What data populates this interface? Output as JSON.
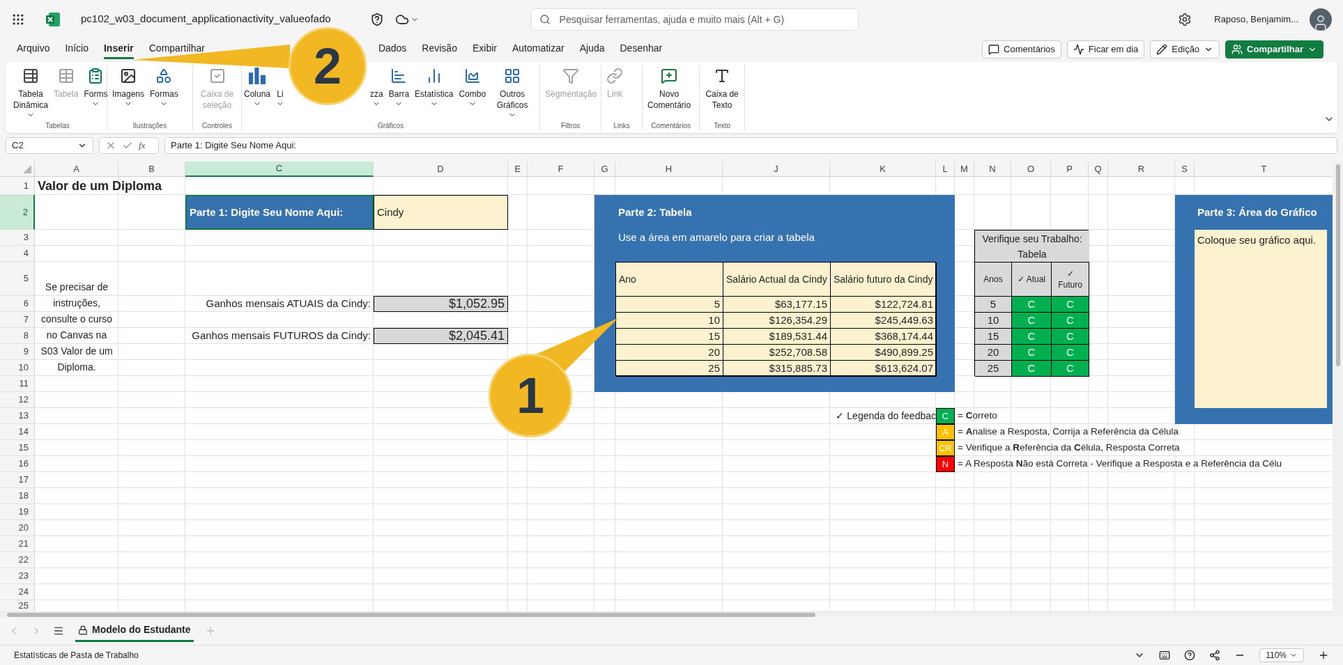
{
  "title_bar": {
    "document_title": "pc102_w03_document_applicationactivity_valueofado",
    "search": {
      "placeholder": "Pesquisar ferramentas, ajuda e muito mais (Alt + G)"
    },
    "user_name": "Raposo, Benjamim..."
  },
  "menu_tabs": [
    {
      "label": "Arquivo",
      "selected": false
    },
    {
      "label": "Início",
      "selected": false
    },
    {
      "label": "Inserir",
      "selected": true
    },
    {
      "label": "Compartilhar",
      "selected": false
    },
    {
      "label": "Dados",
      "selected": false
    },
    {
      "label": "Revisão",
      "selected": false
    },
    {
      "label": "Exibir",
      "selected": false
    },
    {
      "label": "Automatizar",
      "selected": false
    },
    {
      "label": "Ajuda",
      "selected": false
    },
    {
      "label": "Desenhar",
      "selected": false
    }
  ],
  "header_buttons": [
    {
      "label": "Comentários",
      "kind": "comments"
    },
    {
      "label": "Ficar em dia",
      "kind": "catchup"
    },
    {
      "label": "Edição",
      "kind": "editing"
    },
    {
      "label": "Compartilhar",
      "kind": "share"
    }
  ],
  "ribbon": [
    {
      "label": "Tabelas",
      "items": [
        {
          "label": "Tabela Dinâmica",
          "kind": "pivot",
          "disabled": false,
          "menu": true
        },
        {
          "label": "Tabela",
          "kind": "table",
          "disabled": true,
          "menu": false
        },
        {
          "label": "Forms",
          "kind": "forms",
          "disabled": false,
          "menu": true
        }
      ]
    },
    {
      "label": "Ilustrações",
      "items": [
        {
          "label": "Imagens",
          "kind": "image",
          "disabled": false,
          "menu": true
        },
        {
          "label": "Formas",
          "kind": "shapes",
          "disabled": false,
          "menu": true
        }
      ]
    },
    {
      "label": "Controles",
      "items": [
        {
          "label": "Caixa de seleção",
          "kind": "checkbox",
          "disabled": true,
          "menu": false
        }
      ]
    },
    {
      "label": "Gráficos",
      "items": [
        {
          "label": "Coluna",
          "kind": "column",
          "disabled": false,
          "menu": true
        },
        {
          "label": "Li",
          "kind": "partial",
          "disabled": false,
          "menu": true
        },
        {
          "label": "zza",
          "kind": "partial",
          "disabled": false,
          "menu": true
        },
        {
          "label": "Barra",
          "kind": "bar",
          "disabled": false,
          "menu": true
        },
        {
          "label": "Estatística",
          "kind": "stat",
          "disabled": false,
          "menu": true
        },
        {
          "label": "Combo",
          "kind": "combo",
          "disabled": false,
          "menu": true
        },
        {
          "label": "Outros Gráficos",
          "kind": "other",
          "disabled": false,
          "menu": true
        }
      ]
    },
    {
      "label": "Filtros",
      "items": [
        {
          "label": "Segmentação",
          "kind": "slicer",
          "disabled": true,
          "menu": false
        }
      ]
    },
    {
      "label": "Links",
      "items": [
        {
          "label": "Link",
          "kind": "link",
          "disabled": true,
          "menu": false
        }
      ]
    },
    {
      "label": "Comentários",
      "items": [
        {
          "label": "Novo Comentário",
          "kind": "comment",
          "disabled": false,
          "menu": false
        }
      ]
    },
    {
      "label": "Texto",
      "items": [
        {
          "label": "Caixa de Texto",
          "kind": "textbox",
          "disabled": false,
          "menu": false
        }
      ]
    }
  ],
  "formula_bar": {
    "name_box": "C2",
    "function_label": "fx",
    "formula": "Parte 1: Digite Seu Nome Aqui:"
  },
  "column_headers": [
    {
      "label": "A",
      "selected": false
    },
    {
      "label": "B",
      "selected": false
    },
    {
      "label": "C",
      "selected": true
    },
    {
      "label": "D",
      "selected": false
    },
    {
      "label": "E",
      "selected": false
    },
    {
      "label": "F",
      "selected": false
    },
    {
      "label": "G",
      "selected": false
    },
    {
      "label": "H",
      "selected": false
    },
    {
      "label": "J",
      "selected": false
    },
    {
      "label": "K",
      "selected": false
    },
    {
      "label": "L",
      "selected": false
    },
    {
      "label": "M",
      "selected": false
    },
    {
      "label": "N",
      "selected": false
    },
    {
      "label": "O",
      "selected": false
    },
    {
      "label": "P",
      "selected": false
    },
    {
      "label": "Q",
      "selected": false
    },
    {
      "label": "R",
      "selected": false
    },
    {
      "label": "S",
      "selected": false
    },
    {
      "label": "T",
      "selected": false
    }
  ],
  "row_headers": [
    {
      "label": "1",
      "selected": false
    },
    {
      "label": "2",
      "selected": true
    },
    {
      "label": "3",
      "selected": false
    },
    {
      "label": "4",
      "selected": false
    },
    {
      "label": "5",
      "selected": false
    },
    {
      "label": "6",
      "selected": false
    },
    {
      "label": "7",
      "selected": false
    },
    {
      "label": "8",
      "selected": false
    },
    {
      "label": "9",
      "selected": false
    },
    {
      "label": "10",
      "selected": false
    },
    {
      "label": "11",
      "selected": false
    },
    {
      "label": "12",
      "selected": false
    },
    {
      "label": "13",
      "selected": false
    },
    {
      "label": "14",
      "selected": false
    },
    {
      "label": "15",
      "selected": false
    },
    {
      "label": "16",
      "selected": false
    },
    {
      "label": "17",
      "selected": false
    },
    {
      "label": "18",
      "selected": false
    },
    {
      "label": "19",
      "selected": false
    },
    {
      "label": "20",
      "selected": false
    },
    {
      "label": "21",
      "selected": false
    },
    {
      "label": "22",
      "selected": false
    },
    {
      "label": "23",
      "selected": false
    },
    {
      "label": "24",
      "selected": false
    },
    {
      "label": "25",
      "selected": false
    }
  ],
  "sheet": {
    "title": "Valor de um Diploma",
    "part1": {
      "label": "Parte 1: Digite Seu Nome Aqui:",
      "name": "Cindy"
    },
    "instructions": "Se precisar de instruções, consulte o curso no Canvas na S03 Valor de um Diploma.",
    "earnings": [
      {
        "label": "Ganhos mensais ATUAIS da Cindy:",
        "value": "$1,052.95"
      },
      {
        "label": "Ganhos mensais FUTUROS da Cindy:",
        "value": "$2,045.41"
      }
    ],
    "part2": {
      "title": "Parte 2: Tabela",
      "subtitle": "Use a área em amarelo para criar a tabela",
      "columns": [
        "Ano",
        "Salário Actual da Cindy",
        "Salário futuro da Cindy"
      ],
      "rows": [
        [
          "5",
          "$63,177.15",
          "$122,724.81"
        ],
        [
          "10",
          "$126,354.29",
          "$245,449.63"
        ],
        [
          "15",
          "$189,531.44",
          "$368,174.44"
        ],
        [
          "20",
          "$252,708.58",
          "$490,899.25"
        ],
        [
          "25",
          "$315,885.73",
          "$613,624.07"
        ]
      ]
    },
    "check": {
      "title": "Verifique seu Trabalho: Tabela",
      "columns": [
        "Anos",
        "✓ Atual",
        "✓ Futuro"
      ],
      "rows": [
        {
          "year": "5",
          "atual": {
            "label": "C",
            "color": "#00b050"
          },
          "futuro": {
            "label": "C",
            "color": "#00b050"
          }
        },
        {
          "year": "10",
          "atual": {
            "label": "C",
            "color": "#00b050"
          },
          "futuro": {
            "label": "C",
            "color": "#00b050"
          }
        },
        {
          "year": "15",
          "atual": {
            "label": "C",
            "color": "#00b050"
          },
          "futuro": {
            "label": "C",
            "color": "#00b050"
          }
        },
        {
          "year": "20",
          "atual": {
            "label": "C",
            "color": "#00b050"
          },
          "futuro": {
            "label": "C",
            "color": "#00b050"
          }
        },
        {
          "year": "25",
          "atual": {
            "label": "C",
            "color": "#00b050"
          },
          "futuro": {
            "label": "C",
            "color": "#00b050"
          }
        }
      ]
    },
    "part3": {
      "title": "Parte 3: Área do Gráfico",
      "placeholder_text": "Coloque seu gráfico aqui."
    },
    "legend": {
      "label": "✓ Legenda do feedbac",
      "items": [
        {
          "code": "C",
          "color": "#00b050",
          "text": "= **C**orreto"
        },
        {
          "code": "A",
          "color": "#ffc000",
          "text": "= **A**nalise a Resposta, Corrija a Referência da Célula"
        },
        {
          "code": "CR",
          "color": "#ffc000",
          "text": "= Verifique a **R**eferência da **C**élula, Resposta Correta"
        },
        {
          "code": "N",
          "color": "#ff0000",
          "text": "= A Resposta **N**ão está Correta - Verifique a Resposta e a Referência da Célu"
        }
      ]
    }
  },
  "sheet_tabs": [
    {
      "label": "Modelo do Estudante",
      "selected": true
    }
  ],
  "status_bar": {
    "text": "Estatísticas de Pasta de Trabalho",
    "zoom": "110%"
  },
  "callouts": [
    {
      "label": "2"
    },
    {
      "label": "1"
    }
  ]
}
